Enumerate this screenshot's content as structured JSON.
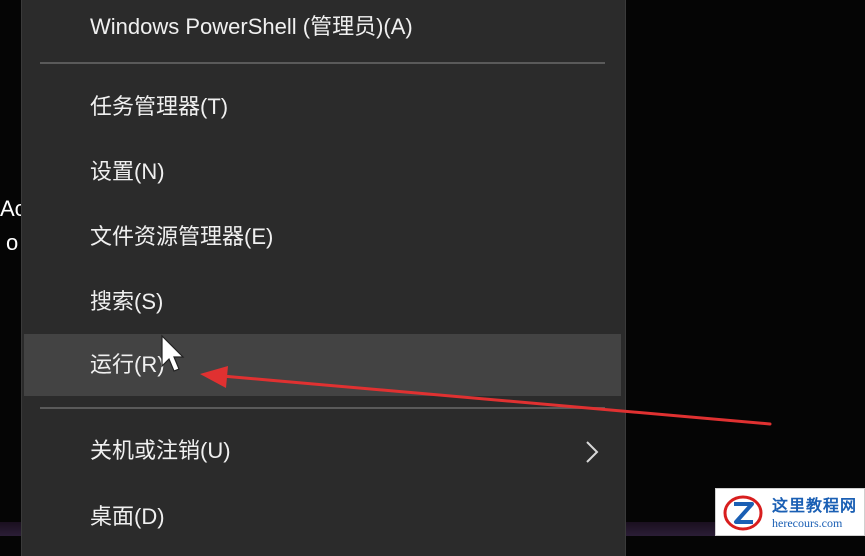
{
  "background_fragments": [
    "Ac",
    "o"
  ],
  "menu": {
    "items_top": [
      {
        "label": "Windows PowerShell (管理员)(A)"
      }
    ],
    "items_mid": [
      {
        "label": "任务管理器(T)"
      },
      {
        "label": "设置(N)"
      },
      {
        "label": "文件资源管理器(E)"
      },
      {
        "label": "搜索(S)"
      },
      {
        "label": "运行(R)"
      }
    ],
    "items_bottom": [
      {
        "label": "关机或注销(U)"
      },
      {
        "label": "桌面(D)"
      }
    ],
    "hovered_item": "运行(R)"
  },
  "icons": {
    "submenu": "chevron-right-icon",
    "cursor": "mouse-pointer-icon",
    "annotation": "red-arrow-icon",
    "watermark_logo": "z-logo-icon"
  },
  "colors": {
    "menu_bg": "#2b2b2b",
    "hover_bg": "#434343",
    "arrow": "#e03131",
    "watermark_text": "#1a5fb4"
  },
  "watermark": {
    "title": "这里教程网",
    "url": "herecours.com"
  }
}
